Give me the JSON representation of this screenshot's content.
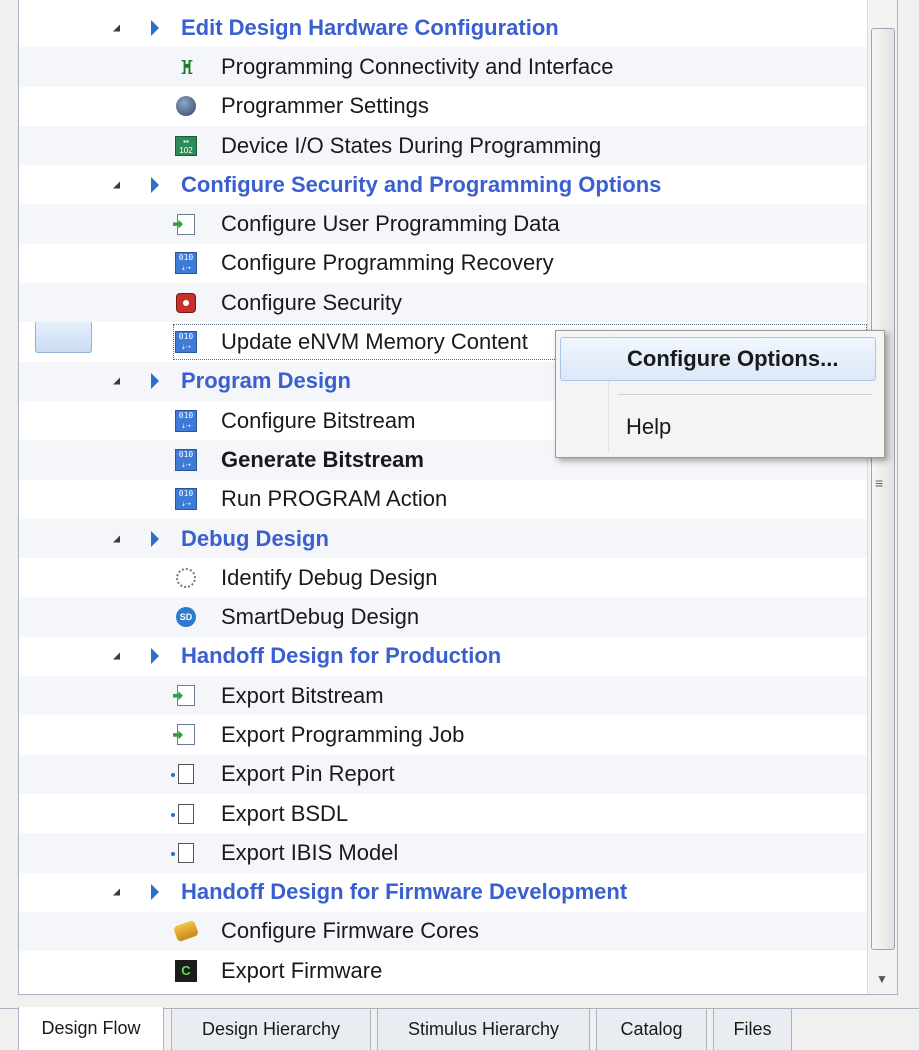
{
  "tree": [
    {
      "type": "category",
      "label": "Edit Design Hardware Configuration"
    },
    {
      "type": "item",
      "label": "Programming Connectivity and Interface",
      "icon": "connectivity-icon"
    },
    {
      "type": "item",
      "label": "Programmer Settings",
      "icon": "programmer-icon"
    },
    {
      "type": "item",
      "label": "Device I/O States During Programming",
      "icon": "io-states-icon"
    },
    {
      "type": "category",
      "label": "Configure Security and Programming Options"
    },
    {
      "type": "item",
      "label": "Configure User Programming Data",
      "icon": "sheet-arrow-icon"
    },
    {
      "type": "item",
      "label": "Configure Programming Recovery",
      "icon": "binary-icon"
    },
    {
      "type": "item",
      "label": "Configure Security",
      "icon": "security-icon"
    },
    {
      "type": "item",
      "label": "Update eNVM Memory Content",
      "icon": "binary-icon",
      "focused": true
    },
    {
      "type": "category",
      "label": "Program Design"
    },
    {
      "type": "item",
      "label": "Configure Bitstream",
      "icon": "binary-icon"
    },
    {
      "type": "item",
      "label": "Generate Bitstream",
      "icon": "binary-icon",
      "bold": true
    },
    {
      "type": "item",
      "label": "Run PROGRAM Action",
      "icon": "binary-icon"
    },
    {
      "type": "category",
      "label": "Debug Design"
    },
    {
      "type": "item",
      "label": "Identify Debug Design",
      "icon": "identify-icon"
    },
    {
      "type": "item",
      "label": "SmartDebug Design",
      "icon": "smartdebug-icon"
    },
    {
      "type": "category",
      "label": "Handoff Design for Production"
    },
    {
      "type": "item",
      "label": "Export Bitstream",
      "icon": "sheet-arrow-icon"
    },
    {
      "type": "item",
      "label": "Export Programming Job",
      "icon": "sheet-arrow-icon"
    },
    {
      "type": "item",
      "label": "Export Pin Report",
      "icon": "document-icon"
    },
    {
      "type": "item",
      "label": "Export BSDL",
      "icon": "document-icon"
    },
    {
      "type": "item",
      "label": "Export IBIS Model",
      "icon": "document-icon"
    },
    {
      "type": "category",
      "label": "Handoff Design for Firmware Development"
    },
    {
      "type": "item",
      "label": "Configure Firmware Cores",
      "icon": "firmware-core-icon"
    },
    {
      "type": "item",
      "label": "Export Firmware",
      "icon": "firmware-icon"
    }
  ],
  "context_menu": {
    "configure_options": "Configure Options...",
    "help": "Help"
  },
  "tabs": [
    {
      "label": "Design Flow",
      "active": true
    },
    {
      "label": "Design Hierarchy",
      "active": false
    },
    {
      "label": "Stimulus Hierarchy",
      "active": false
    },
    {
      "label": "Catalog",
      "active": false
    },
    {
      "label": "Files",
      "active": false
    }
  ],
  "colors": {
    "category_text": "#3a5fcf",
    "arrow": "#2f6fc9",
    "menu_highlight": "#dbe8f8"
  }
}
